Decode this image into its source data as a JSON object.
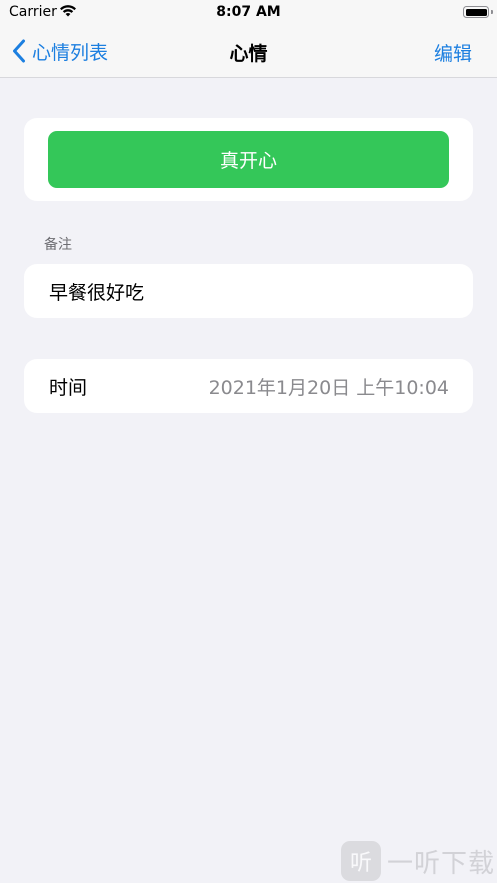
{
  "status_bar": {
    "carrier": "Carrier",
    "time": "8:07 AM"
  },
  "nav": {
    "back_label": "心情列表",
    "title": "心情",
    "edit_label": "编辑"
  },
  "mood": {
    "button_label": "真开心",
    "color": "#34c759"
  },
  "notes": {
    "header": "备注",
    "text": "早餐很好吃"
  },
  "time_row": {
    "label": "时间",
    "value": "2021年1月20日  上午10:04"
  },
  "watermark": {
    "logo_glyph": "听",
    "text": "一听下载"
  },
  "colors": {
    "accent": "#1c7fe0",
    "background": "#f2f2f7",
    "button_green": "#34c759"
  }
}
